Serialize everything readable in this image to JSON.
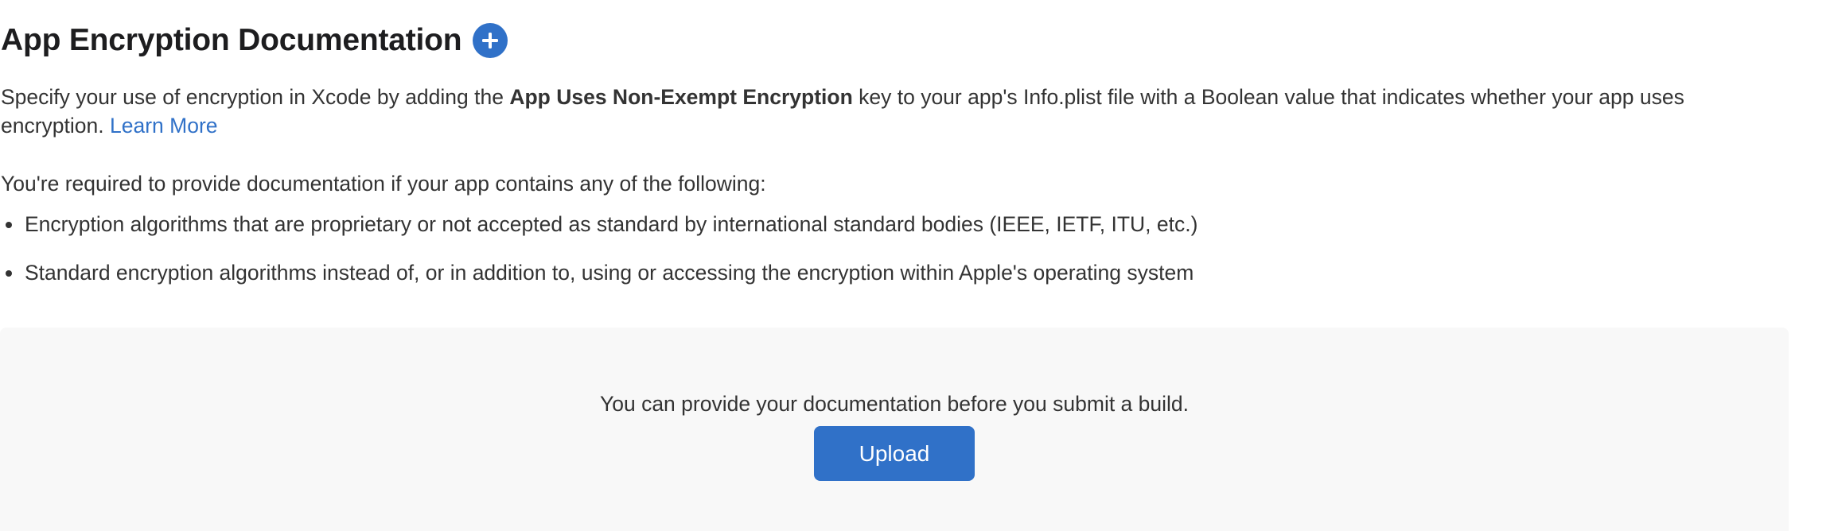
{
  "section": {
    "title": "App Encryption Documentation",
    "add_icon": "plus-circle-icon",
    "description_before": "Specify your use of encryption in Xcode by adding the ",
    "description_bold": "App Uses Non-Exempt Encryption",
    "description_after": " key to your app's Info.plist file with a Boolean value that indicates whether your app uses encryption. ",
    "learn_more": "Learn More",
    "requirement_intro": "You're required to provide documentation if your app contains any of the following:",
    "bullets": [
      "Encryption algorithms that are proprietary or not accepted as standard by international standard bodies (IEEE, IETF, ITU, etc.)",
      "Standard encryption algorithms instead of, or in addition to, using or accessing the encryption within Apple's operating system"
    ]
  },
  "upload_panel": {
    "message": "You can provide your documentation before you submit a build.",
    "button_label": "Upload"
  },
  "colors": {
    "accent": "#3071c8",
    "text": "#333333",
    "panel_bg": "#f8f8f8"
  }
}
